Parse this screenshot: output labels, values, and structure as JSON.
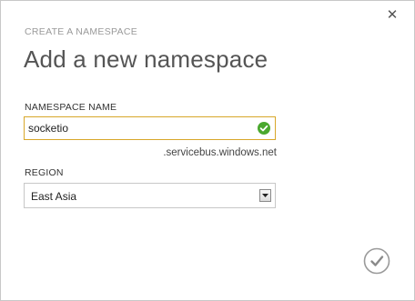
{
  "dialog": {
    "subtitle": "CREATE A NAMESPACE",
    "title": "Add a new namespace",
    "close_icon": "close-icon"
  },
  "namespace": {
    "label": "NAMESPACE NAME",
    "value": "socketio",
    "suffix": ".servicebus.windows.net",
    "valid_icon": "checkmark-circle-icon",
    "valid_color": "#4aa82e",
    "border_color": "#d8a72a"
  },
  "region": {
    "label": "REGION",
    "selected": "East Asia",
    "arrow_icon": "chevron-down-icon"
  },
  "footer": {
    "confirm_icon": "checkmark-circle-outline-icon"
  }
}
